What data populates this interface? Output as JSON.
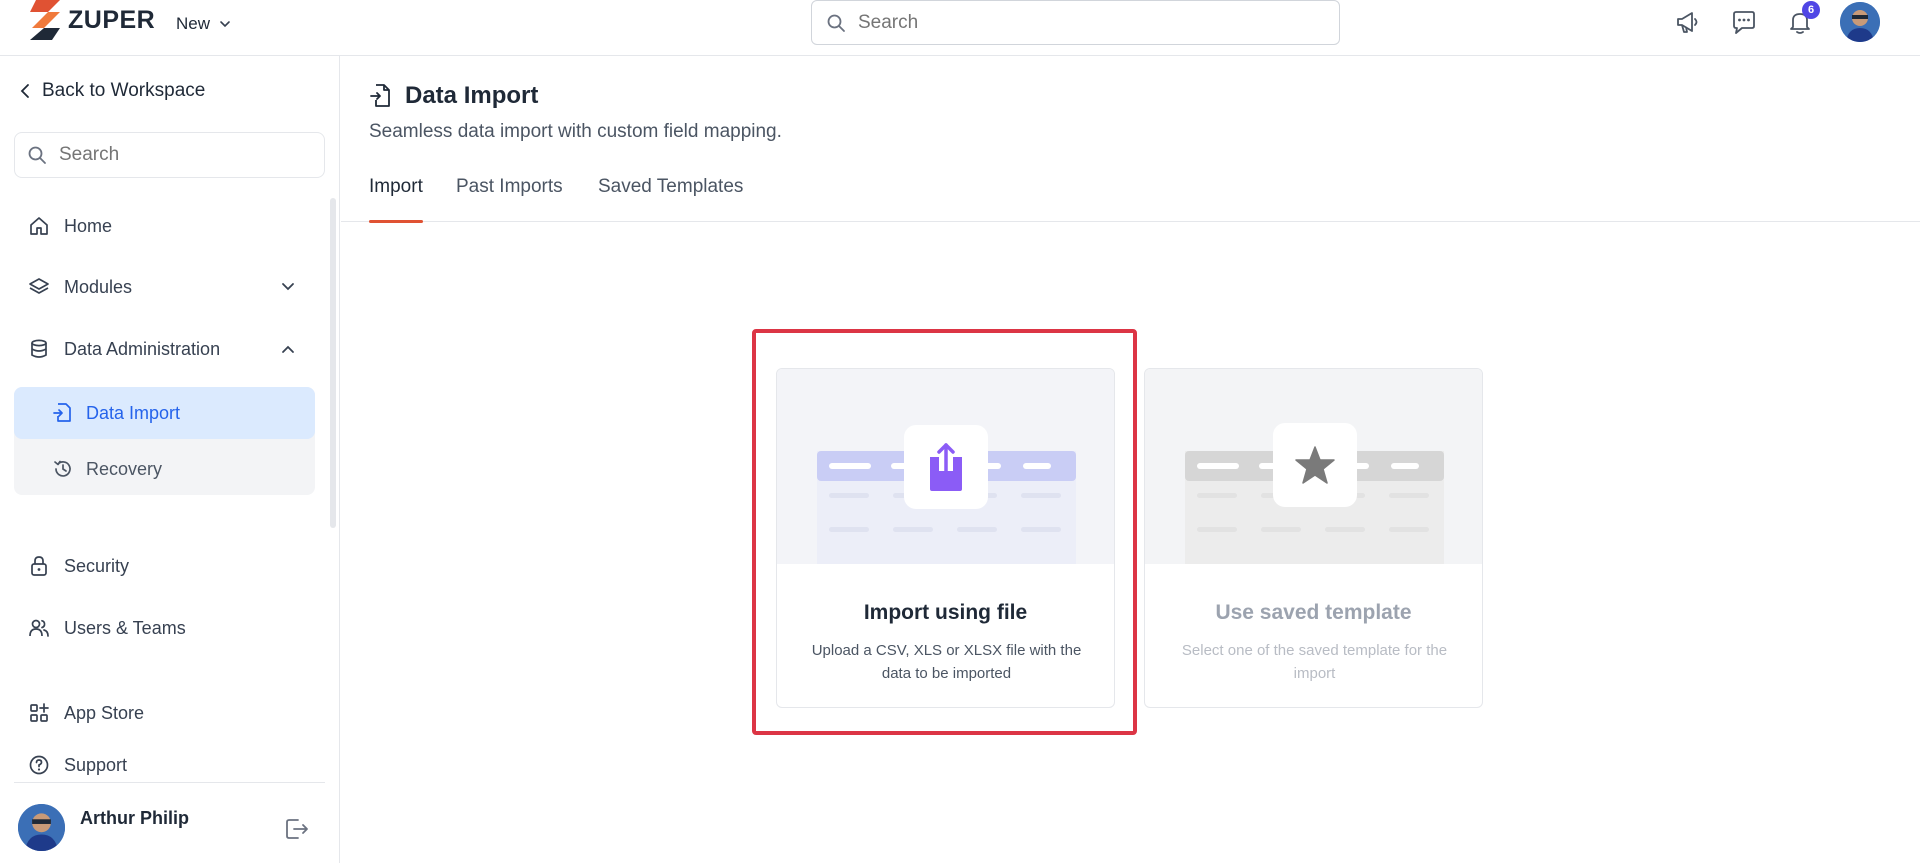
{
  "header": {
    "brand": "ZUPER",
    "new_label": "New",
    "search_placeholder": "Search",
    "notification_count": "6"
  },
  "sidebar": {
    "back_label": "Back to Workspace",
    "search_placeholder": "Search",
    "items": [
      {
        "label": "Home",
        "icon": "home-icon"
      },
      {
        "label": "Modules",
        "icon": "layers-icon"
      },
      {
        "label": "Data Administration",
        "icon": "database-icon"
      },
      {
        "label": "Security",
        "icon": "lock-icon"
      },
      {
        "label": "Users & Teams",
        "icon": "users-icon"
      },
      {
        "label": "App Store",
        "icon": "grid-plus-icon"
      },
      {
        "label": "Support",
        "icon": "help-circle-icon"
      }
    ],
    "sub_items": [
      {
        "label": "Data Import",
        "icon": "file-import-icon",
        "active": true
      },
      {
        "label": "Recovery",
        "icon": "history-icon",
        "active": false
      }
    ],
    "user": {
      "name": "Arthur Philip"
    }
  },
  "main": {
    "title": "Data Import",
    "subtitle": "Seamless data import with custom field mapping.",
    "tabs": [
      {
        "label": "Import",
        "active": true
      },
      {
        "label": "Past Imports",
        "active": false
      },
      {
        "label": "Saved Templates",
        "active": false
      }
    ],
    "cards": [
      {
        "title": "Import using file",
        "desc": "Upload a CSV, XLS or XLSX file with the data to be imported",
        "icon": "upload-icon",
        "enabled": true
      },
      {
        "title": "Use saved template",
        "desc": "Select one of the saved template for the import",
        "icon": "star-icon",
        "enabled": false
      }
    ]
  },
  "colors": {
    "accent": "#e05233",
    "active_nav_bg": "#dbeafe",
    "active_nav_text": "#2563eb",
    "upload_icon": "#8b5cf6",
    "highlight": "#dc3545",
    "badge": "#4f46e5"
  }
}
